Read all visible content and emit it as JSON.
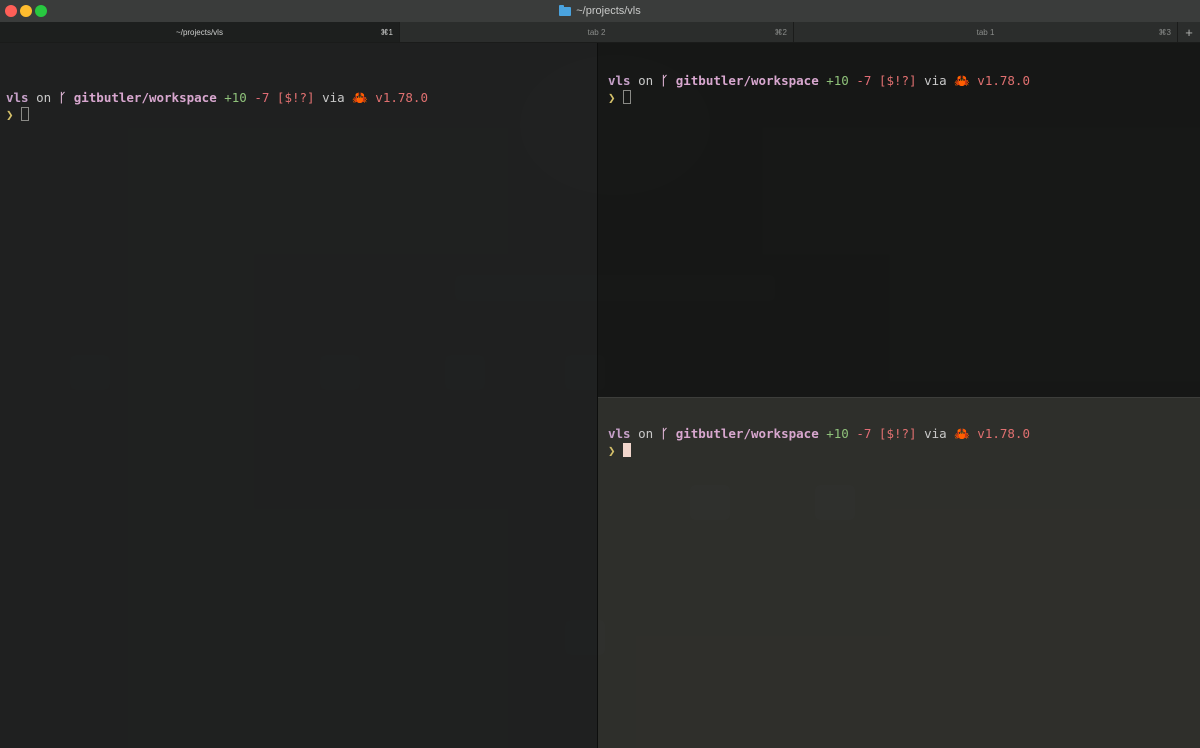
{
  "window": {
    "title": "~/projects/vls"
  },
  "tabs": [
    {
      "label": "~/projects/vls",
      "shortcut": "⌘1",
      "active": true
    },
    {
      "label": "tab 2",
      "shortcut": "⌘2",
      "active": false
    },
    {
      "label": "tab 1",
      "shortcut": "⌘3",
      "active": false
    }
  ],
  "new_tab_label": "+",
  "prompt": {
    "dir": "vls",
    "on": " on ",
    "branch_icon": "ᚴ",
    "branch": " gitbutler/workspace",
    "added": " +10",
    "removed": " -7",
    "status": " [$!?]",
    "via": " via ",
    "crab": "🦀",
    "version": " v1.78.0",
    "arrow": "❯ "
  },
  "panes": [
    {
      "name": "left",
      "cursor_active": false
    },
    {
      "name": "right-top",
      "cursor_active": false
    },
    {
      "name": "right-bottom",
      "cursor_active": true
    }
  ],
  "colors": {
    "traffic_close": "#ff5f57",
    "traffic_minimize": "#febc2e",
    "traffic_maximize": "#28c840",
    "prompt_dir": "#c6a0c8",
    "prompt_added": "#8fc27a",
    "prompt_removed": "#e06c75",
    "prompt_arrow": "#d4c06a"
  }
}
